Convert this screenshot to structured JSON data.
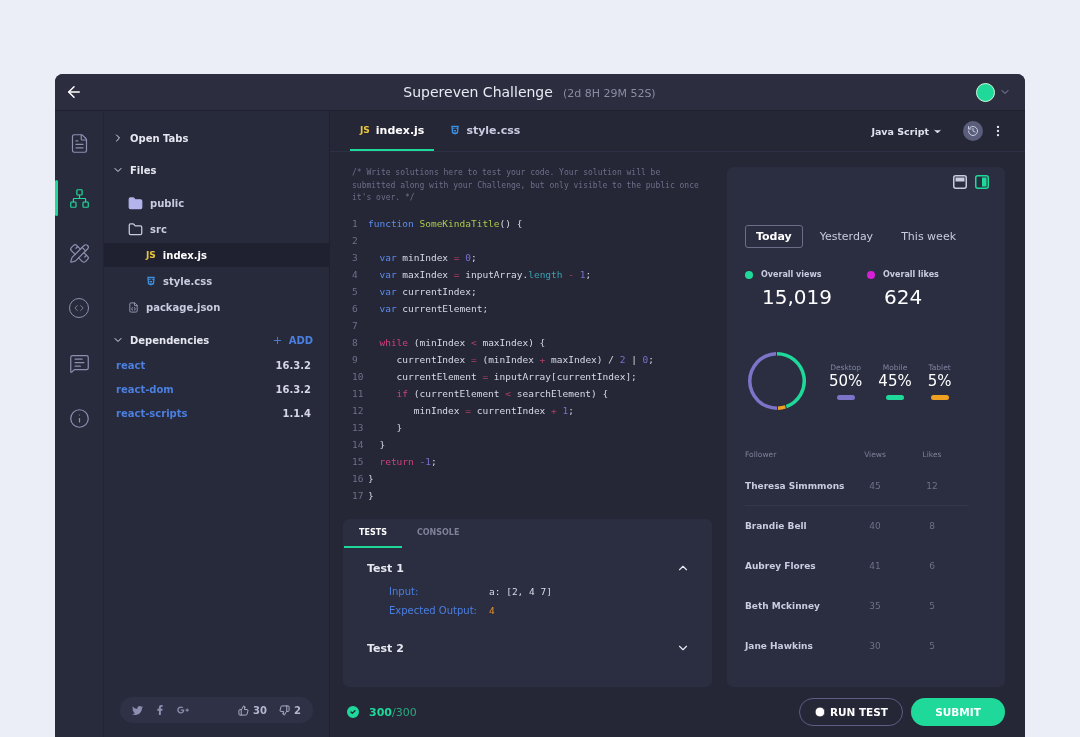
{
  "header": {
    "title": "Supereven Challenge",
    "timer": "(2d 8H 29M 52S)"
  },
  "rail": [
    {
      "kind": "file",
      "selected": false
    },
    {
      "kind": "tree",
      "selected": true
    },
    {
      "kind": "tools",
      "selected": false
    },
    {
      "kind": "code",
      "selected": false
    },
    {
      "kind": "chat",
      "selected": false
    },
    {
      "kind": "info",
      "selected": false
    }
  ],
  "explorer": {
    "open_tabs": {
      "label": "Open Tabs",
      "expanded": false
    },
    "files": {
      "label": "Files",
      "expanded": true,
      "children": [
        {
          "name": "public",
          "kind": "folder",
          "selected": false
        },
        {
          "name": "src",
          "kind": "folder-open",
          "selected": false,
          "children": [
            {
              "name": "index.js",
              "kind": "js",
              "badge": "JS",
              "selected": true
            },
            {
              "name": "style.css",
              "kind": "css",
              "selected": false
            }
          ]
        },
        {
          "name": "package.json",
          "kind": "json",
          "selected": false
        }
      ]
    },
    "dependencies": {
      "label": "Dependencies",
      "expanded": true,
      "add": "ADD",
      "items": [
        {
          "name": "react",
          "version": "16.3.2"
        },
        {
          "name": "react-dom",
          "version": "16.3.2"
        },
        {
          "name": "react-scripts",
          "version": "1.1.4"
        }
      ]
    }
  },
  "social": {
    "likes": "30",
    "dislikes": "2"
  },
  "editor": {
    "tabs": [
      {
        "label": "index.js",
        "kind": "js",
        "badge": "JS",
        "selected": true
      },
      {
        "label": "style.css",
        "kind": "css",
        "selected": false
      }
    ],
    "language": "Java Script",
    "comment": "/* Write solutions here to test your code. Your solution will be submitted along with your Challenge, but only visible to the public once it's over. */",
    "lines": [
      {
        "number": "1",
        "tokens": [
          {
            "kind": "kw",
            "text": "function"
          },
          {
            "kind": "fn",
            "text": " SomeKindaTitle"
          },
          {
            "kind": "plain",
            "text": "() {"
          }
        ]
      },
      {
        "number": "2"
      },
      {
        "number": "3",
        "tokens": [
          {
            "kind": "kw",
            "text": "  var"
          },
          {
            "kind": "plain",
            "text": " minIndex "
          },
          {
            "kind": "op",
            "text": "="
          },
          {
            "kind": "num",
            "text": " 0"
          },
          {
            "kind": "plain",
            "text": ";"
          }
        ]
      },
      {
        "number": "4",
        "tokens": [
          {
            "kind": "kw",
            "text": "  var"
          },
          {
            "kind": "plain",
            "text": " maxIndex "
          },
          {
            "kind": "op",
            "text": "="
          },
          {
            "kind": "plain",
            "text": " inputArray."
          },
          {
            "kind": "prop",
            "text": "length"
          },
          {
            "kind": "op",
            "text": " -"
          },
          {
            "kind": "num",
            "text": " 1"
          },
          {
            "kind": "plain",
            "text": ";"
          }
        ]
      },
      {
        "number": "5",
        "tokens": [
          {
            "kind": "kw",
            "text": "  var"
          },
          {
            "kind": "plain",
            "text": " currentIndex;"
          }
        ]
      },
      {
        "number": "6",
        "tokens": [
          {
            "kind": "kw",
            "text": "  var"
          },
          {
            "kind": "plain",
            "text": " currentElement;"
          }
        ]
      },
      {
        "number": "7"
      },
      {
        "number": "8",
        "tokens": [
          {
            "kind": "ctl",
            "text": "  while"
          },
          {
            "kind": "plain",
            "text": " (minIndex "
          },
          {
            "kind": "op",
            "text": "<"
          },
          {
            "kind": "plain",
            "text": " maxIndex) {"
          }
        ]
      },
      {
        "number": "9",
        "tokens": [
          {
            "kind": "plain",
            "text": "     currentIndex "
          },
          {
            "kind": "op",
            "text": "="
          },
          {
            "kind": "plain",
            "text": " (minIndex "
          },
          {
            "kind": "op",
            "text": "+"
          },
          {
            "kind": "plain",
            "text": " maxIndex) / "
          },
          {
            "kind": "num",
            "text": "2"
          },
          {
            "kind": "plain",
            "text": " | "
          },
          {
            "kind": "num",
            "text": "0"
          },
          {
            "kind": "plain",
            "text": ";"
          }
        ]
      },
      {
        "number": "10",
        "tokens": [
          {
            "kind": "plain",
            "text": "     currentElement "
          },
          {
            "kind": "op",
            "text": "="
          },
          {
            "kind": "plain",
            "text": " inputArray[currentIndex];"
          }
        ]
      },
      {
        "number": "11",
        "tokens": [
          {
            "kind": "ctl",
            "text": "     if"
          },
          {
            "kind": "plain",
            "text": " (currentElement "
          },
          {
            "kind": "op",
            "text": "<"
          },
          {
            "kind": "plain",
            "text": " searchElement) {"
          }
        ]
      },
      {
        "number": "12",
        "tokens": [
          {
            "kind": "plain",
            "text": "        minIndex "
          },
          {
            "kind": "op",
            "text": "="
          },
          {
            "kind": "plain",
            "text": " currentIndex "
          },
          {
            "kind": "op",
            "text": "+"
          },
          {
            "kind": "num",
            "text": " 1"
          },
          {
            "kind": "plain",
            "text": ";"
          }
        ]
      },
      {
        "number": "13",
        "tokens": [
          {
            "kind": "plain",
            "text": "     }"
          }
        ]
      },
      {
        "number": "14",
        "tokens": [
          {
            "kind": "plain",
            "text": "  }"
          }
        ]
      },
      {
        "number": "15",
        "tokens": [
          {
            "kind": "ctl",
            "text": "  return"
          },
          {
            "kind": "num",
            "text": " -1"
          },
          {
            "kind": "plain",
            "text": ";"
          }
        ]
      },
      {
        "number": "16",
        "tokens": [
          {
            "kind": "plain",
            "text": "}"
          }
        ]
      },
      {
        "number": "17",
        "tokens": [
          {
            "kind": "plain",
            "text": "}"
          }
        ]
      }
    ]
  },
  "tests": {
    "tabs": [
      {
        "label": "TESTS",
        "selected": true
      },
      {
        "label": "CONSOLE",
        "selected": false
      }
    ],
    "items": [
      {
        "title": "Test 1",
        "expanded": true,
        "fields": [
          {
            "label": "Input:",
            "value": "a: [2, 4 7]",
            "kind": "code"
          },
          {
            "label": "Expected Output:",
            "value": "4",
            "kind": "number"
          }
        ]
      },
      {
        "title": "Test 2",
        "expanded": false
      }
    ]
  },
  "score": {
    "passed": "300",
    "total": "/300"
  },
  "stats": {
    "layouts": [
      {
        "kind": "rows",
        "selected": false
      },
      {
        "kind": "columns",
        "selected": true
      }
    ],
    "periods": [
      {
        "label": "Today",
        "selected": true
      },
      {
        "label": "Yesterday",
        "selected": false
      },
      {
        "label": "This week",
        "selected": false
      }
    ],
    "metrics": [
      {
        "label": "Overall views",
        "value": "15,019",
        "color": "#1fd99a"
      },
      {
        "label": "Overall likes",
        "value": "624",
        "color": "#d61fd6"
      }
    ],
    "chart_data": {
      "type": "donut",
      "categories": [
        "Desktop",
        "Mobile",
        "Tablet"
      ],
      "values": [
        50,
        45,
        5
      ],
      "value_labels": [
        "50%",
        "45%",
        "5%"
      ],
      "colors": [
        "#7b74c9",
        "#1fd99a",
        "#f0a020"
      ]
    },
    "table": {
      "columns": [
        "Follower",
        "Views",
        "Likes"
      ],
      "rows": [
        [
          "Theresa Simmmons",
          "45",
          "12"
        ],
        [
          "Brandie Bell",
          "40",
          "8"
        ],
        [
          "Aubrey Flores",
          "41",
          "6"
        ],
        [
          "Beth Mckinney",
          "35",
          "5"
        ],
        [
          "Jane Hawkins",
          "30",
          "5"
        ]
      ]
    }
  },
  "actions": {
    "run": "RUN TEST",
    "submit": "SUBMIT"
  }
}
